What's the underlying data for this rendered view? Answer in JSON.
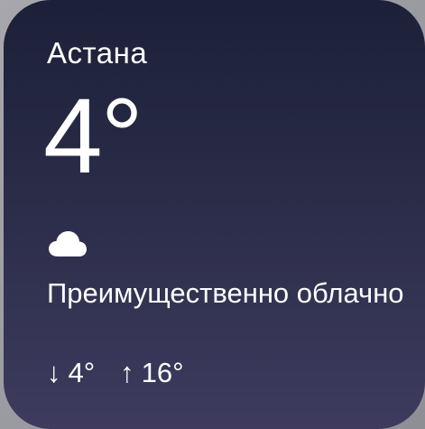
{
  "widget": {
    "city": "Астана",
    "temperature": "4°",
    "icon": "cloud-icon",
    "condition": "Преимущественно облачно",
    "low_arrow": "↓",
    "low": "4°",
    "high_arrow": "↑",
    "high": "16°"
  },
  "colors": {
    "background_top": "#1c2038",
    "background_bottom": "#3e3b5e",
    "text": "#ffffff"
  }
}
